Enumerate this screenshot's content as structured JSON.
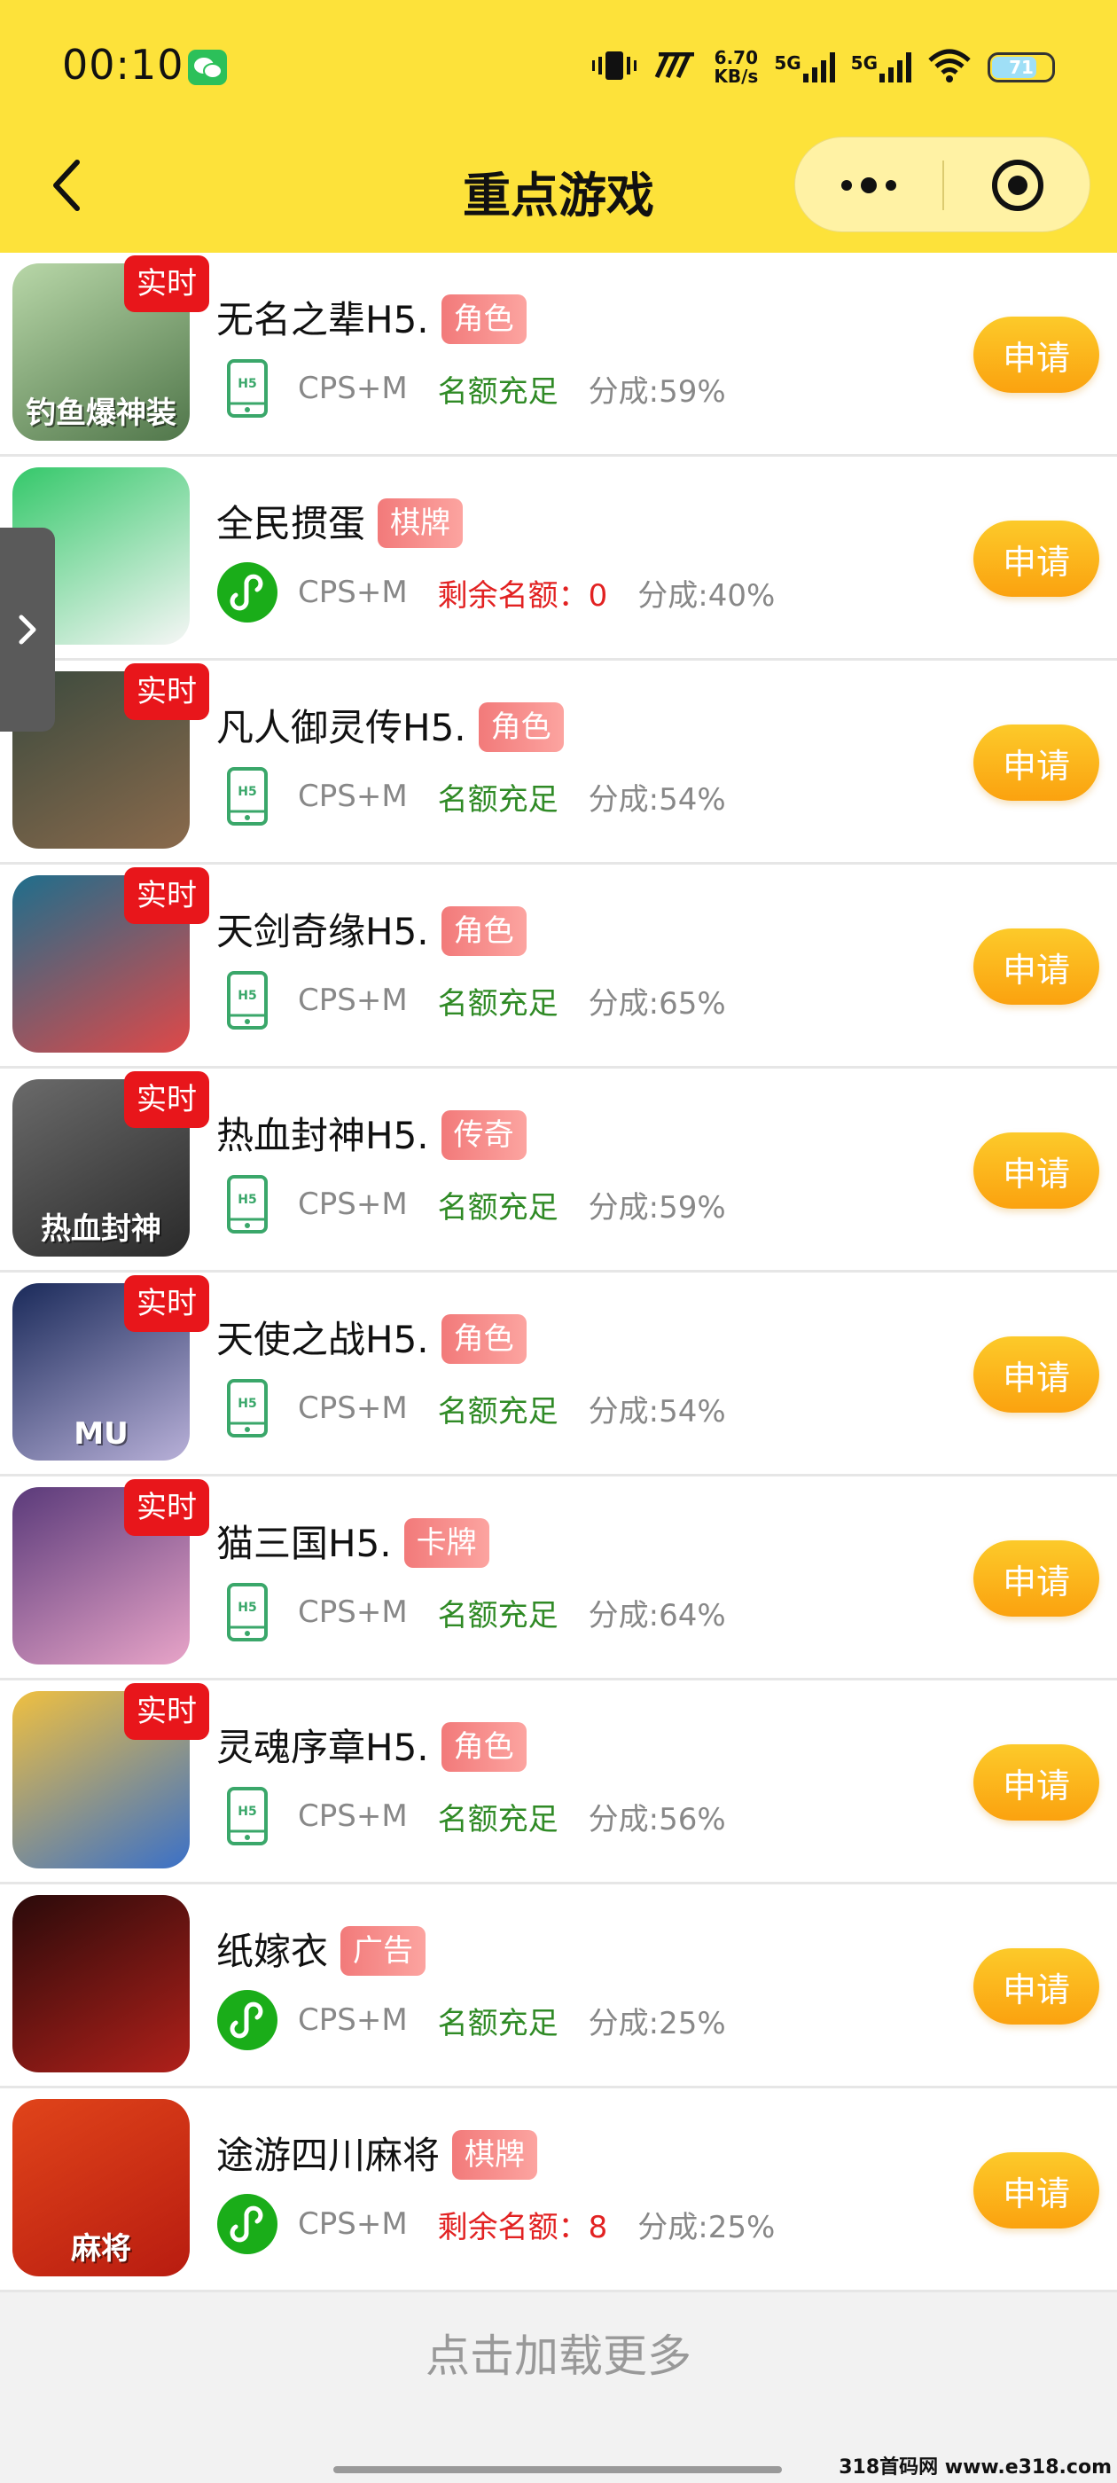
{
  "status_bar": {
    "time": "00:10",
    "net_speed_value": "6.70",
    "net_speed_unit": "KB/s",
    "signal_1": "5G",
    "signal_2": "5G",
    "battery": "71"
  },
  "nav": {
    "title": "重点游戏"
  },
  "games": [
    {
      "name": "无名之辈H5.",
      "tag": "角色",
      "realtime": "实时",
      "platform": "h5",
      "cps": "CPS+M",
      "quota": "名额充足",
      "quota_ok": true,
      "share": "分成:59%",
      "apply": "申请",
      "icon_text": "钓鱼爆神装",
      "icon_colors": [
        "#b8d7a8",
        "#50764a"
      ]
    },
    {
      "name": "全民掼蛋",
      "tag": "棋牌",
      "realtime": "",
      "platform": "mini",
      "cps": "CPS+M",
      "quota": "剩余名额：0",
      "quota_ok": false,
      "share": "分成:40%",
      "apply": "申请",
      "icon_text": "",
      "icon_colors": [
        "#34c86a",
        "#f6f6f6"
      ]
    },
    {
      "name": "凡人御灵传H5.",
      "tag": "角色",
      "realtime": "实时",
      "platform": "h5",
      "cps": "CPS+M",
      "quota": "名额充足",
      "quota_ok": true,
      "share": "分成:54%",
      "apply": "申请",
      "icon_text": "",
      "icon_colors": [
        "#3b4a3e",
        "#8a6a4c"
      ]
    },
    {
      "name": "天剑奇缘H5.",
      "tag": "角色",
      "realtime": "实时",
      "platform": "h5",
      "cps": "CPS+M",
      "quota": "名额充足",
      "quota_ok": true,
      "share": "分成:65%",
      "apply": "申请",
      "icon_text": "",
      "icon_colors": [
        "#1e6e8c",
        "#e04848"
      ]
    },
    {
      "name": "热血封神H5.",
      "tag": "传奇",
      "realtime": "实时",
      "platform": "h5",
      "cps": "CPS+M",
      "quota": "名额充足",
      "quota_ok": true,
      "share": "分成:59%",
      "apply": "申请",
      "icon_text": "热血封神",
      "icon_colors": [
        "#6a6a6a",
        "#2a2a2a"
      ]
    },
    {
      "name": "天使之战H5.",
      "tag": "角色",
      "realtime": "实时",
      "platform": "h5",
      "cps": "CPS+M",
      "quota": "名额充足",
      "quota_ok": true,
      "share": "分成:54%",
      "apply": "申请",
      "icon_text": "MU",
      "icon_colors": [
        "#1a2a5a",
        "#b8b0d8"
      ]
    },
    {
      "name": "猫三国H5.",
      "tag": "卡牌",
      "realtime": "实时",
      "platform": "h5",
      "cps": "CPS+M",
      "quota": "名额充足",
      "quota_ok": true,
      "share": "分成:64%",
      "apply": "申请",
      "icon_text": "",
      "icon_colors": [
        "#5a3a7a",
        "#e8a4c8"
      ]
    },
    {
      "name": "灵魂序章H5.",
      "tag": "角色",
      "realtime": "实时",
      "platform": "h5",
      "cps": "CPS+M",
      "quota": "名额充足",
      "quota_ok": true,
      "share": "分成:56%",
      "apply": "申请",
      "icon_text": "",
      "icon_colors": [
        "#f0c040",
        "#3a70c8"
      ]
    },
    {
      "name": "纸嫁衣",
      "tag": "广告",
      "realtime": "",
      "platform": "mini",
      "cps": "CPS+M",
      "quota": "名额充足",
      "quota_ok": true,
      "share": "分成:25%",
      "apply": "申请",
      "icon_text": "",
      "icon_colors": [
        "#2a0a0a",
        "#b0201a"
      ]
    },
    {
      "name": "途游四川麻将",
      "tag": "棋牌",
      "realtime": "",
      "platform": "mini",
      "cps": "CPS+M",
      "quota": "剩余名额：8",
      "quota_ok": false,
      "share": "分成:25%",
      "apply": "申请",
      "icon_text": "麻将",
      "icon_colors": [
        "#e0441a",
        "#b81c10"
      ]
    }
  ],
  "load_more": "点击加载更多",
  "watermark": "318首码网 www.e318.com"
}
